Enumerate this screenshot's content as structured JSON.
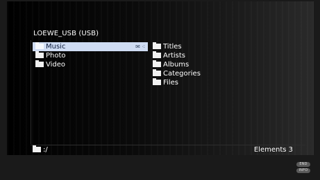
{
  "header": {
    "device_title": "LOEWE_USB (USB)"
  },
  "left_list": [
    {
      "label": "Music",
      "selected": true
    },
    {
      "label": "Photo",
      "selected": false
    },
    {
      "label": "Video",
      "selected": false
    }
  ],
  "selected_item_icons": {
    "left": "✉",
    "right": "⁖"
  },
  "right_list": [
    {
      "label": "Titles"
    },
    {
      "label": "Artists"
    },
    {
      "label": "Albums"
    },
    {
      "label": "Categories"
    },
    {
      "label": "Files"
    }
  ],
  "footer": {
    "path": ":/",
    "elements": "Elements 3",
    "hint_end": "END",
    "hint_info": "INFO"
  },
  "colors": {
    "selection": "#cfdcf3",
    "text": "#ffffff"
  }
}
